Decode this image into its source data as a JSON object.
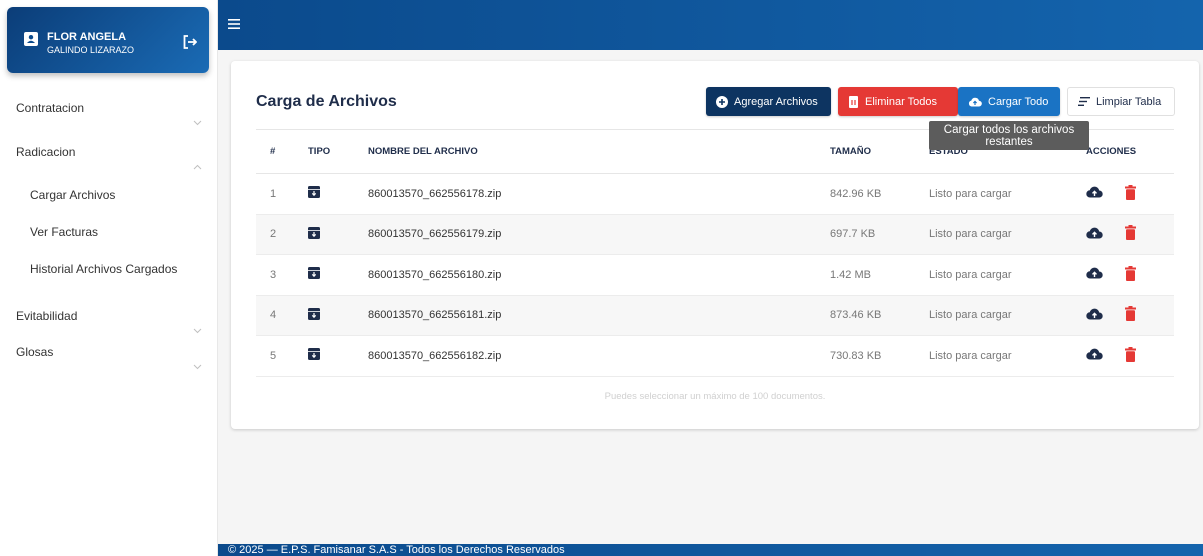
{
  "user": {
    "first_name": "FLOR ANGELA",
    "last_name": "GALINDO LIZARAZO"
  },
  "sidebar": {
    "items": [
      {
        "label": "Contratacion",
        "expanded": false
      },
      {
        "label": "Radicacion",
        "expanded": true,
        "children": [
          "Cargar Archivos",
          "Ver Facturas",
          "Historial Archivos Cargados"
        ]
      },
      {
        "label": "Evitabilidad",
        "expanded": false
      },
      {
        "label": "Glosas",
        "expanded": false
      }
    ]
  },
  "main": {
    "title": "Carga de Archivos",
    "buttons": {
      "add": "Agregar Archivos",
      "delete_all": "Eliminar Todos",
      "upload_all": "Cargar Todo",
      "clear": "Limpiar Tabla"
    },
    "tooltip": "Cargar todos los archivos restantes",
    "table": {
      "headers": [
        "#",
        "TIPO",
        "NOMBRE DEL ARCHIVO",
        "TAMAÑO",
        "ESTADO",
        "ACCIONES"
      ],
      "rows": [
        {
          "n": "1",
          "name": "860013570_662556178.zip",
          "size": "842.96 KB",
          "state": "Listo para cargar"
        },
        {
          "n": "2",
          "name": "860013570_662556179.zip",
          "size": "697.7 KB",
          "state": "Listo para cargar"
        },
        {
          "n": "3",
          "name": "860013570_662556180.zip",
          "size": "1.42 MB",
          "state": "Listo para cargar"
        },
        {
          "n": "4",
          "name": "860013570_662556181.zip",
          "size": "873.46 KB",
          "state": "Listo para cargar"
        },
        {
          "n": "5",
          "name": "860013570_662556182.zip",
          "size": "730.83 KB",
          "state": "Listo para cargar"
        }
      ]
    },
    "hint": "Puedes seleccionar un máximo de 100 documentos."
  },
  "footer": {
    "text": "© 2025 — E.P.S. Famisanar S.A.S - Todos los Derechos Reservados"
  },
  "colors": {
    "primary": "#0d3461",
    "danger": "#e53935",
    "info": "#1a73c4",
    "header": "#1464ad"
  },
  "icons": {
    "user": "id-badge-icon",
    "logout": "logout-icon",
    "menu": "hamburger-icon",
    "type": "archive-box-icon",
    "upload": "cloud-upload-icon",
    "delete": "trash-icon"
  }
}
